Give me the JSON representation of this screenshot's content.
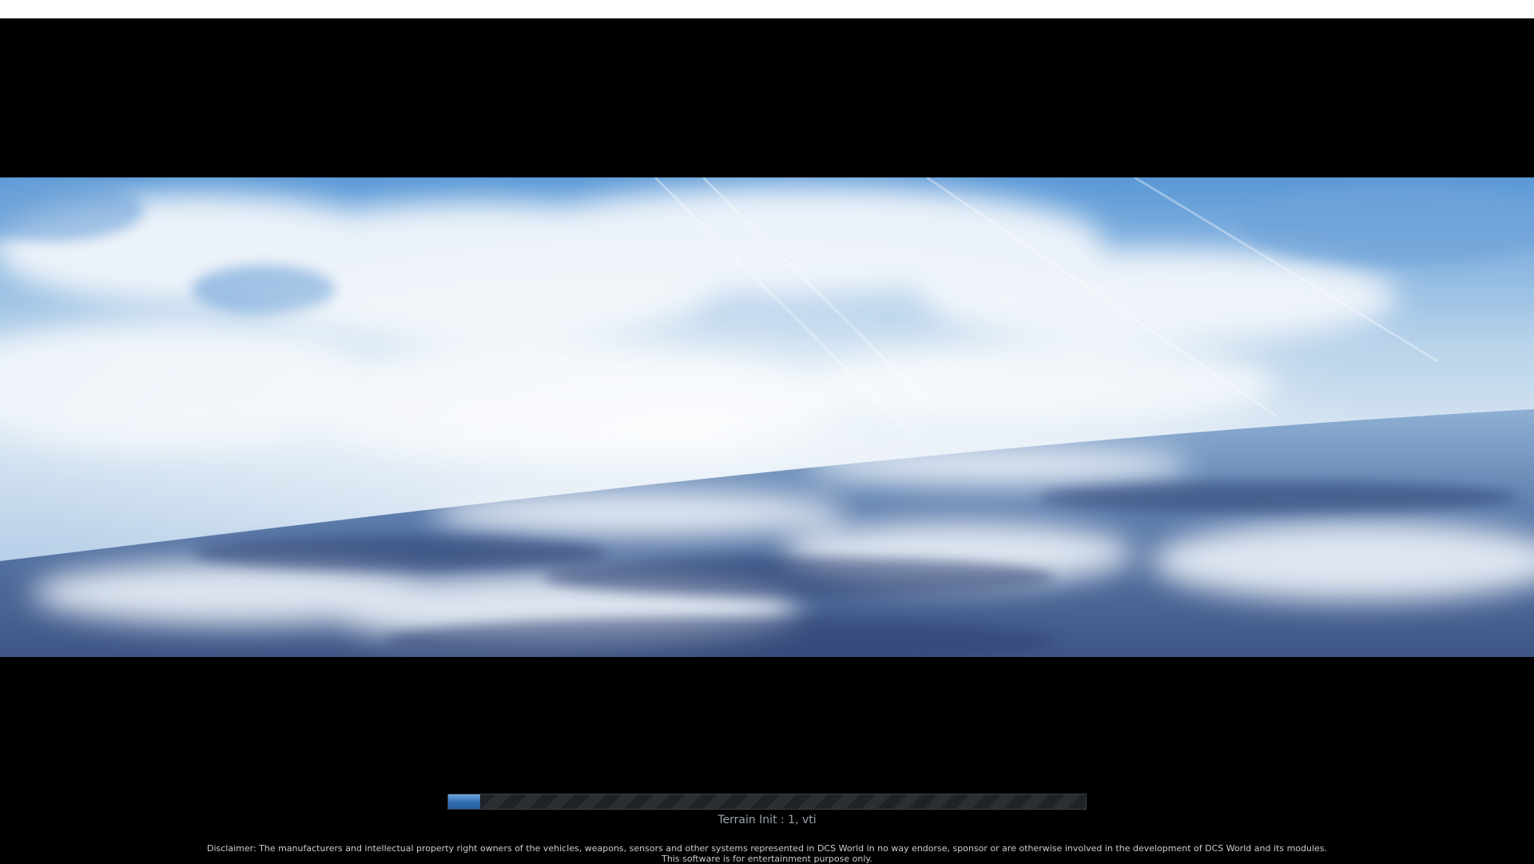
{
  "loading": {
    "progress": 0.05,
    "status_text": "Terrain Init : 1, vti",
    "disclaimer_line1": "Disclaimer: The manufacturers and intellectual property right owners of the vehicles, weapons, sensors and other systems represented in DCS World in no way endorse, sponsor or are otherwise involved in the development of DCS World and its modules.",
    "disclaimer_line2": "This software is for entertainment purpose only."
  },
  "colors": {
    "progress_fill": "#2f6db0",
    "background": "#000000",
    "sky_blue": "#4f8fd0",
    "cloud_white": "#e8eef5"
  }
}
